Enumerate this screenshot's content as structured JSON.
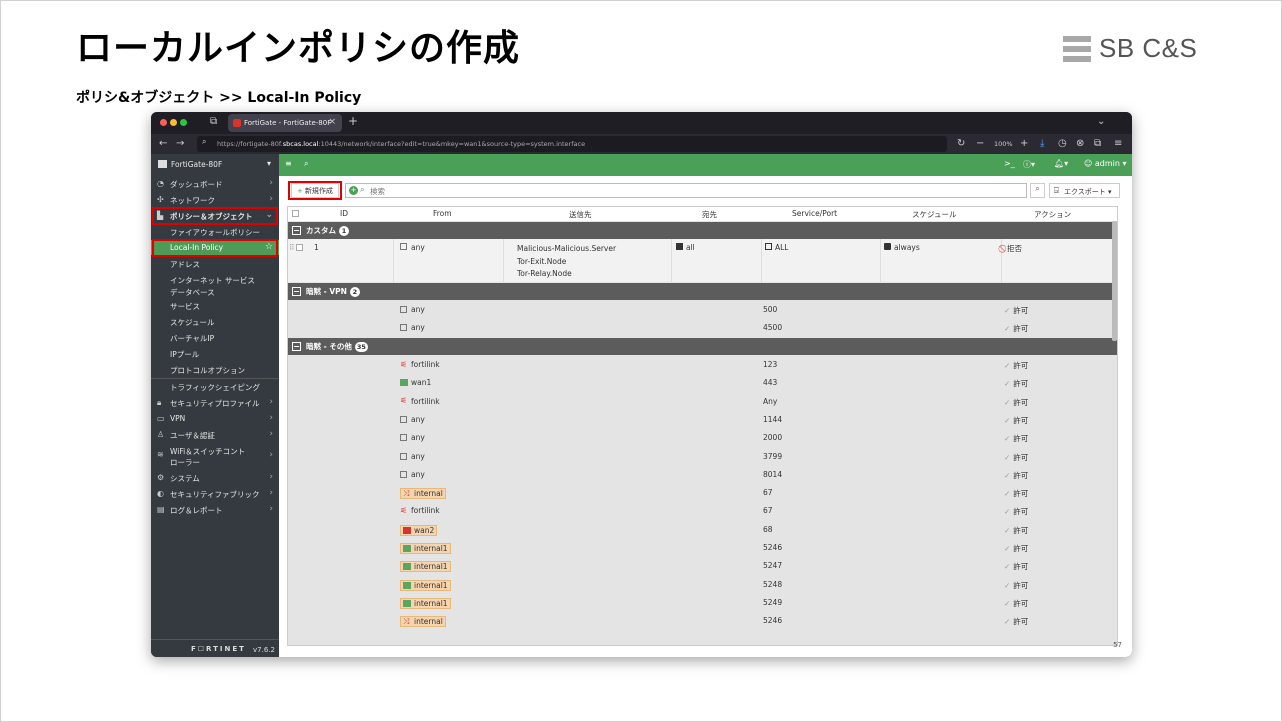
{
  "slide": {
    "title": "ローカルインポリシの作成",
    "breadcrumb": "ポリシ&オブジェクト >> Local-In Policy",
    "logo_text": "SB C&S"
  },
  "browser": {
    "tab_title": "FortiGate - FortiGate-80F",
    "url_prefix": "https://fortigate-80f.",
    "url_host": "sbcas.local",
    "url_suffix": ":10443/network/interface?edit=true&mkey=wan1&source-type=system.interface",
    "zoom": "100%"
  },
  "sidebar": {
    "device": "FortiGate-80F",
    "items": [
      {
        "label": "ダッシュボード",
        "icon": "dashboard-icon"
      },
      {
        "label": "ネットワーク",
        "icon": "network-icon"
      },
      {
        "label": "ポリシー＆オブジェクト",
        "icon": "policy-icon"
      },
      {
        "label": "ファイアウォールポリシー"
      },
      {
        "label": "Local-In Policy"
      },
      {
        "label": "アドレス"
      },
      {
        "label": "インターネット サービス"
      },
      {
        "label": "データベース"
      },
      {
        "label": "サービス"
      },
      {
        "label": "スケジュール"
      },
      {
        "label": "バーチャルIP"
      },
      {
        "label": "IPプール"
      },
      {
        "label": "プロトコルオプション"
      },
      {
        "label": "トラフィックシェイピング"
      },
      {
        "label": "セキュリティプロファイル",
        "icon": "lock-icon"
      },
      {
        "label": "VPN",
        "icon": "vpn-icon"
      },
      {
        "label": "ユーザ＆認証",
        "icon": "user-icon"
      },
      {
        "label": "WiFi＆スイッチコント",
        "icon": "wifi-icon"
      },
      {
        "label": "ローラー"
      },
      {
        "label": "システム",
        "icon": "gear-icon"
      },
      {
        "label": "セキュリティファブリック",
        "icon": "fabric-icon"
      },
      {
        "label": "ログ＆レポート",
        "icon": "chart-icon"
      }
    ],
    "brand": "F☐RTINET",
    "version": "v7.6.2"
  },
  "topbar": {
    "user": "admin"
  },
  "toolbar": {
    "create_label": "新規作成",
    "search_placeholder": "検索",
    "export_label": "エクスポート"
  },
  "table": {
    "columns": [
      "ID",
      "From",
      "送信先",
      "宛先",
      "Service/Port",
      "スケジュール",
      "アクション"
    ],
    "groups": [
      {
        "name": "カスタム",
        "count": "1"
      },
      {
        "name": "暗黙 - VPN",
        "count": "2"
      },
      {
        "name": "暗黙 - その他",
        "count": "35"
      }
    ],
    "custom_row": {
      "id": "1",
      "from": "any",
      "dest": [
        "Malicious-Malicious.Server",
        "Tor-Exit.Node",
        "Tor-Relay.Node"
      ],
      "to": "all",
      "service": "ALL",
      "schedule": "always",
      "action": "拒否"
    },
    "vpn_rows": [
      {
        "src": "any",
        "port": "500",
        "action": "許可"
      },
      {
        "src": "any",
        "port": "4500",
        "action": "許可"
      }
    ],
    "other_rows": [
      {
        "src": "fortilink",
        "kind": "red",
        "port": "123",
        "action": "許可"
      },
      {
        "src": "wan1",
        "kind": "green",
        "port": "443",
        "action": "許可"
      },
      {
        "src": "fortilink",
        "kind": "red",
        "port": "Any",
        "action": "許可"
      },
      {
        "src": "any",
        "kind": "box",
        "port": "1144",
        "action": "許可"
      },
      {
        "src": "any",
        "kind": "box",
        "port": "2000",
        "action": "許可"
      },
      {
        "src": "any",
        "kind": "box",
        "port": "3799",
        "action": "許可"
      },
      {
        "src": "any",
        "kind": "box",
        "port": "8014",
        "action": "許可"
      },
      {
        "src": "internal",
        "kind": "tag-red",
        "port": "67",
        "action": "許可"
      },
      {
        "src": "fortilink",
        "kind": "red",
        "port": "67",
        "action": "許可"
      },
      {
        "src": "wan2",
        "kind": "tag-redsq",
        "port": "68",
        "action": "許可"
      },
      {
        "src": "internal1",
        "kind": "tag-green",
        "port": "5246",
        "action": "許可"
      },
      {
        "src": "internal1",
        "kind": "tag-green",
        "port": "5247",
        "action": "許可"
      },
      {
        "src": "internal1",
        "kind": "tag-green",
        "port": "5248",
        "action": "許可"
      },
      {
        "src": "internal1",
        "kind": "tag-green",
        "port": "5249",
        "action": "許可"
      },
      {
        "src": "internal",
        "kind": "tag-red",
        "port": "5246",
        "action": "許可"
      }
    ],
    "page_count": "57"
  }
}
